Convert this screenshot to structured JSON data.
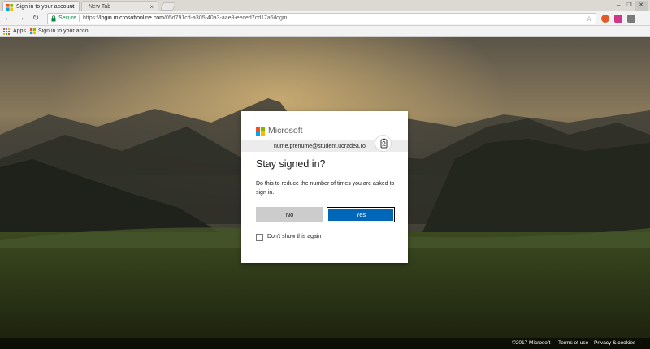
{
  "browser": {
    "tabs": [
      {
        "title": "Sign in to your account",
        "active": true
      },
      {
        "title": "New Tab",
        "active": false
      }
    ],
    "tab_close_glyph": "×",
    "window_controls": {
      "minimize": "–",
      "maximize": "❐",
      "close": "✕"
    },
    "nav": {
      "back_icon": "←",
      "forward_icon": "→",
      "reload_icon": "↻"
    },
    "address": {
      "secure_label": "Secure",
      "scheme": "https://",
      "host": "login.microsoftonline.com",
      "path": "/05d791cd-a305-40a3-aae8-eeced7cd17a5/login"
    },
    "star_icon": "☆",
    "bookmarks": [
      {
        "label": "Apps",
        "icon": "apps-grid-icon"
      },
      {
        "label": "Sign in to your acco",
        "icon": "microsoft-favicon-icon"
      }
    ],
    "extensions": [
      {
        "name": "extension-orange-icon",
        "color": "#e05a2b"
      },
      {
        "name": "extension-pink-icon",
        "color": "#d0368a"
      },
      {
        "name": "extension-profile-icon",
        "color": "#7a7a7a"
      }
    ]
  },
  "dialog": {
    "brand": "Microsoft",
    "logo_colors": [
      "#f25022",
      "#7fba00",
      "#00a4ef",
      "#ffb900"
    ],
    "account_email": "nume.prenume@student.uoradea.ro",
    "title": "Stay signed in?",
    "description": "Do this to reduce the number of times you are asked to sign in.",
    "no_label": "No",
    "yes_label": "Yes",
    "checkbox_label": "Don't show this again",
    "checkbox_checked": false
  },
  "footer": {
    "copyright": "©2017 Microsoft",
    "terms": "Terms of use",
    "privacy": "Privacy & cookies",
    "more": "···"
  },
  "colors": {
    "accent": "#0067b8",
    "secure_green": "#0b8043"
  }
}
